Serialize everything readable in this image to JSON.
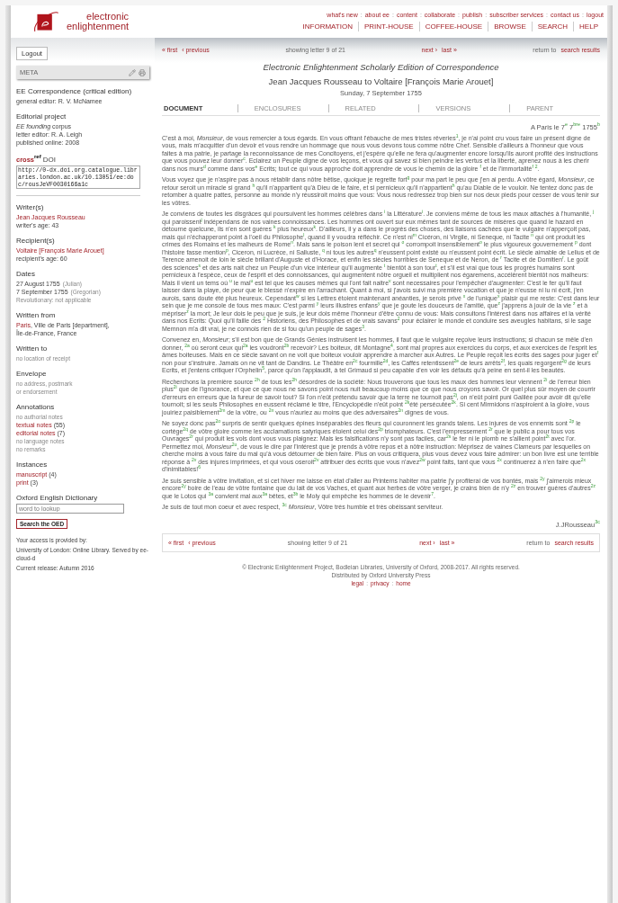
{
  "header": {
    "logo_lines": [
      "electronic",
      "enlightenment"
    ],
    "top_links": [
      "what's new",
      "about ee",
      "content",
      "collaborate",
      "publish",
      "subscriber services",
      "contact us",
      "logout"
    ],
    "top_links_separator": ":",
    "menu": [
      "INFORMATION",
      "PRINT-HOUSE",
      "COFFEE-HOUSE",
      "BROWSE",
      "SEARCH",
      "HELP"
    ]
  },
  "sidebar": {
    "logout": "Logout",
    "meta_title": "META",
    "sections": [
      {
        "kind": "info",
        "heading": "EE Correspondence (critical edition)",
        "lines": [
          [
            {
              "kind": "text",
              "text": "general editor: R. V. McNamee"
            }
          ]
        ]
      },
      {
        "kind": "info",
        "heading": "Editorial project",
        "lines": [
          [
            {
              "kind": "em",
              "text": "EE founding"
            },
            {
              "kind": "text",
              "text": " corpus"
            }
          ],
          [
            {
              "kind": "text",
              "text": "letter editor: R. A. Leigh"
            }
          ],
          [
            {
              "kind": "text",
              "text": "published online: 2008"
            }
          ]
        ]
      },
      {
        "kind": "doi",
        "brand": "cross",
        "brand_sup": "ref",
        "label": "DOI",
        "value": "http://0-dx.doi.org.catalogue.libraries.london.ac.uk/10.13051/ee:doc/rousJeVF0030166a1c"
      },
      {
        "kind": "info",
        "heading": "Writer(s)",
        "lines": [
          [
            {
              "kind": "link",
              "text": "Jean Jacques Rousseau"
            }
          ],
          [
            {
              "kind": "text",
              "text": "writer's age: 43"
            }
          ]
        ]
      },
      {
        "kind": "info",
        "heading": "Recipient(s)",
        "lines": [
          [
            {
              "kind": "link",
              "text": "Voltaire [François Marie Arouet]"
            }
          ],
          [
            {
              "kind": "text",
              "text": "recipient's age: 60"
            }
          ]
        ]
      },
      {
        "kind": "info",
        "heading": "Dates",
        "lines": [
          [
            {
              "kind": "text",
              "text": "27 August 1755"
            },
            {
              "kind": "note",
              "text": "(Julian)"
            }
          ],
          [
            {
              "kind": "text",
              "text": "7 September 1755"
            },
            {
              "kind": "note",
              "text": "(Gregorian)"
            }
          ],
          [
            {
              "kind": "muted",
              "text": "Revolutionary: not applicable"
            }
          ]
        ]
      },
      {
        "kind": "info",
        "heading": "Written from",
        "lines": [
          [
            {
              "kind": "link",
              "text": "Paris"
            },
            {
              "kind": "text",
              "text": ", Ville de Paris [department],"
            }
          ],
          [
            {
              "kind": "text",
              "text": "Île-de-France, France"
            }
          ]
        ]
      },
      {
        "kind": "info",
        "heading": "Written to",
        "lines": [
          [
            {
              "kind": "muted",
              "text": "no location of receipt"
            }
          ]
        ]
      },
      {
        "kind": "info",
        "heading": "Envelope",
        "lines": [
          [
            {
              "kind": "muted",
              "text": "no address, postmark"
            }
          ],
          [
            {
              "kind": "muted",
              "text": "or endorsement"
            }
          ]
        ]
      },
      {
        "kind": "info",
        "heading": "Annotations",
        "lines": [
          [
            {
              "kind": "muted",
              "text": "no authorial notes"
            }
          ],
          [
            {
              "kind": "link",
              "text": "textual notes"
            },
            {
              "kind": "text",
              "text": " (55)"
            }
          ],
          [
            {
              "kind": "link",
              "text": "editorial notes"
            },
            {
              "kind": "text",
              "text": " (7)"
            }
          ],
          [
            {
              "kind": "muted",
              "text": "no language notes"
            }
          ],
          [
            {
              "kind": "muted",
              "text": "no remarks"
            }
          ]
        ]
      },
      {
        "kind": "info",
        "heading": "Instances",
        "lines": [
          [
            {
              "kind": "link",
              "text": "manuscript"
            },
            {
              "kind": "text",
              "text": " (4)"
            }
          ],
          [
            {
              "kind": "link",
              "text": "print"
            },
            {
              "kind": "text",
              "text": " (3)"
            }
          ]
        ]
      },
      {
        "kind": "lookup",
        "heading": "Oxford English Dictionary",
        "placeholder": "word to lookup",
        "button": "Search the OED"
      },
      {
        "kind": "access",
        "lines": [
          "Your access is provided by:",
          "University of London: Online Library. Served by ee-cloud-d",
          "Current release: Autumn 2016"
        ]
      }
    ]
  },
  "nav_top": {
    "first": "« first",
    "previous": "‹ previous",
    "status": "showing letter 9 of 21",
    "next": "next ›",
    "last": "last »",
    "return_prefix": "return to",
    "return_link": "search results"
  },
  "edition": "Electronic Enlightenment Scholarly Edition of Correspondence",
  "letter_title": "Jean Jacques Rousseau to Voltaire [François Marie Arouet]",
  "letter_date": "Sunday, 7 September 1755",
  "tabs": [
    {
      "label": "DOCUMENT",
      "selected": true,
      "disabled": false
    },
    {
      "label": "ENCLOSURES",
      "selected": false,
      "disabled": true
    },
    {
      "label": "RELATED",
      "selected": false,
      "disabled": true
    },
    {
      "label": "VERSIONS",
      "selected": false,
      "disabled": true
    },
    {
      "label": "PARENT",
      "selected": false,
      "disabled": true
    }
  ],
  "dateline": "A Paris le 7$^{e}$ 7$^{bre}$ 1755$^{b}$",
  "paragraphs": [
    "C'est à moi, *Monsieur*, de vous remercier à tous égards. En vous offrant l'ébauche de mes tristes rêveries$^{1}$, je n'ai point cru vous faire un présent digne de vous, mais m'acquitter d'un devoir et vous rendre un hommage que nous vous devons tous comme nôtre Chef. Sensible d'ailleurs à l'honneur que vous faites à ma patrie, je partage la reconnoissance de mes Concitoyens, et j'espère qu'elle ne fera qu'augmenter encore lorsqu'ils auront profité des instructions que vous pouvez leur donner$^{c}$. Eclairez un Peuple digne de vos leçons, et vous qui savez si bien peindre les vertus et la liberté, aprenez nous à les cherir dans nos murs$^{d}$ comme dans vos$^{e}$ Ecrits; tout ce qui vous approche doit apprendre de vous le chemin de la gloire $^{f}$ et de l'immortalité$^{f}$ $^{2}$.",
    "Vous voyez que je n'aspire pas à nous rétablir dans nôtre bêtise, quoique je regrette fort$^{g}$ pour ma part le peu que j'en ai perdu. A vôtre égard, *Monsieur*, ce retour seroit un miracle si grand $^{h}$ qu'il n'appartient qu'à Dieu de le faire, et si pernicieux qu'il n'appartient$^{h}$ qu'au Diable de le vouloir. Ne tentez donc pas de retomber à quatre pattes, personne au monde n'y réussiroit moins que vous: Vous nous redressez trop bien sur nos deux pieds pour cesser de vous tenir sur les vôtres.",
    "Je conviens de toutes les disgrâces qui poursuivent les hommes célèbres dans $^{i}$ la Littérature$^{i}$. Je conviens même de tous les maux attachés à l'humanité, $^{j}$ qui paroissent$^{j}$ indépendans de nos vaines connoissances. Les hommes ont ouvert sur eux mêmes tant de sources de misères que quand le hazard en détourne quelcune, ils n'en sont guères $^{k}$ plus heureux$^{k}$. D'ailleurs, il y a dans le progrès des choses, des liaisons cachées que le vulgaire n'apperçoit pas, mais qui n'échapperont point à l'oeil du Philosophe$^{l}$, quand il y voudra réfléchir. Ce n'est ni$^{m}$ Cicéron, ni Virgile, ni Seneque, ni Tacite $^{n}$ qui ont produit les crimes des Romains et les malheurs de Rome$^{n}$. Mais sans le poison lent et secret qui $^{o}$ corrompoit insensiblement$^{o}$ le plus vigoureux gouvernement $^{p}$ dont l'histoire fasse mention$^{p}$, Ciceron, ni Lucrèce, ni Salluste, $^{q}$ ni tous les autres$^{q}$ n'eussent point existé ou n'eussent point écrit. Le siècle aimable de Lelius et de Terence amenoit de loin le siècle brillant d'Auguste et d'Horace, et enfin les siècles horribles de Seneque et de Neron, de $^{r}$ Tacite et de Domitien$^{r}$. Le goût des sciences$^{s}$ et des arts nait chez un Peuple d'un vice intérieur qu'il augmente $^{t}$ bientôt à son tour$^{t}$, et s'il est vrai que tous les progrès humains sont pernicieux à l'espèce, ceux de l'esprit et des connoissances, qui augmentent nôtre orgueil et multiplient nos égaremens, accélèrent bientôt nos malheurs: Mais il vient un tems où $^{u}$ le mal$^{u}$ est tel que les causes mêmes qui l'ont fait naitre$^{v}$ sont necessaires pour l'empêcher d'augmenter: C'est le fer qu'il faut laisser dans la playe, de peur que le blessé n'expire en l'arrachant. Quant à moi, si j'avois suivi ma première vocation et que je n'eusse ni lu ni écrit, j'en aurois, sans doute été plus heureux. Cependant$^{w}$ si les Lettres étoient maintenant anéanties, je serois privé $^{x}$ de l'unique$^{x}$ plaisir qui me reste: C'est dans leur sein que je me console de tous mes maux: C'est parmi $^{y}$ leurs illustres enfans$^{y}$ que je goute les douceurs de l'amitié, que$^{z}$ j'apprens à jouir de la vie $^{z}$ et à mépriser$^{z}$ la mort; Je leur dois le peu que je suis, je leur dois même l'honneur d'être connu de vous: Mais consultons l'intérest dans nos affaires et la vérité dans nos Ecrits: Quoi qu'il faille des $^{2}$ Historiens, des Philosophes et de vrais savans$^{2}$ pour éclairer le monde et conduire ses aveugles habitans, si le sage Memnon m'a dit vrai, je ne connois rien de si fou qu'un peuple de sages$^{3}$.",
    "Convenez en, *Monsieur*; s'il est bon que de Grands Génies instruisent les hommes, il faut que le vulgaire reçoive leurs instructions; si chacun se mêle d'en donner, $^{2a}$ où seront ceux qui$^{2a}$ les voudront$^{2b}$ recevoir? Les boiteux, dit Montagne$^{4}$, sont mal propres aux exercices du corps, et aux exercices de l'esprit les âmes boiteuses. Mais en ce siècle savant on ne voit que boiteux vouloir apprendre à marcher aux Autres. Le Peuple reçoit les écrits des sages pour juger et$^{f}$ non pour s'instruire. Jamais on ne vit tant de Dandins. Le Théâtre en$^{2c}$ fourmille$^{2d}$, les Caffés retentissent$^{2e}$ de leurs arrêts$^{2f}$, les quais regorgent$^{2g}$ de leurs Ecrits, et j'entens critiquer l'Orphelin$^{5}$, parce qu'on l'applaudit, à tel Grimaud si peu capable d'en voir les défauts qu'à peine en sent-il les beautés.",
    "Recherchons la première source $^{2h}$ de tous les$^{2h}$ désordres de la société: Nous trouverons que tous les maux des hommes leur viennent $^{2i}$ de l'erreur bien plus$^{2i}$ que de l'ignorance, et que ce que nous ne savons point nous nuit beaucoup moins que ce que nous croyons savoir. Or quel plus sûr moyen de courrir d'erreurs en erreurs que la fureur de savoir tout? Si l'on n'eût prétendu savoir que la terre ne tournoit pas$^{2j}$, on n'eût point puni Galilée pour avoir dit qu'elle tournoit; si les seuls Philosophes en eussent réclamé le titre, l'Encyclopédie n'eût point $^{2k}$été persécutée$^{2k}$. Si cent Mirmidons n'aspiroient à la gloire, vous jouiriez paisiblement$^{2m}$ de la vôtre, ou $^{2n}$ vous n'auriez au moins que des adversaires$^{2n}$ dignes de vous.",
    "Ne soyez donc pas$^{2o}$ surpris de sentir quelques épines inséparables des fleurs qui couronnent les grands talens. Les injures de vos ennemis sont $^{2p}$ le cortège$^{2q}$ de vôtre gloire comme les acclamations satyriques étoient celui des$^{2p}$ triomphateurs. C'est l'empressement $^{2r}$ que le public a pour tous vos Ouvrages$^{2r}$ qui produit les vols dont vous vous plaignez: Mais les falsifications n'y sont pas faciles, car$^{2s}$ le fer ni le plomb ne s'allient point$^{2t}$ avec l'or. Permettez moi, *Monsieur*$^{2u}$, de vous le dire par l'intérest que je prends à vôtre repos et à nôtre instruction: Méprisez de vaines Clameurs par lesquelles on cherche moins à vous faire du mal qu'à vous détourner de bien faire. Plus on vous critiquera, plus vous devez vous faire admirer: un bon livre est une terrible réponse à $^{2v}$ des injures imprimées, et qui vous oseroit$^{2v}$ attribuer des écrits que vous n'avez$^{2w}$ point faits, tant que vous $^{2x}$ continuerez à n'en faire que$^{2x}$ d'inimitables!$^{6}$",
    "Je suis sensible à vôtre invitation, et si cet hiver me laisse en état d'aller au Printems habiter ma patrie j'y profiterai de vos bontés, mais $^{2y}$ j'aimerois mieux encore$^{2y}$ boire de l'eau de vôtre fontaine que du lait de vos Vaches, et quant aux herbes de vôtre verger, je crains bien de n'y $^{2z}$ en trouver guères d'autres$^{2z}$ que le Lotos qui $^{3a}$ convient mal aux$^{3a}$ bêtes, et$^{3b}$ le Moly qui empêche les hommes de le devenir$^{7}$.",
    "Je suis de tout mon coeur et avec respect, $^{3c}$ *Monsieur*, Vôtre très humble et très obéissant serviteur."
  ],
  "signature": "J.JRousseau$^{3c}$",
  "nav_bottom": {
    "first": "« first",
    "previous": "‹ previous",
    "status": "showing letter 9 of 21",
    "next": "next ›",
    "last": "last »",
    "return_prefix": "return to",
    "return_link": "search results"
  },
  "footer": {
    "copyright": "© Electronic Enlightenment Project, Bodleian Libraries, University of Oxford, 2008-2017. All rights reserved.",
    "distributor": "Distributed by Oxford University Press",
    "links_separator": ":",
    "links": [
      "legal",
      "privacy",
      "home"
    ]
  }
}
